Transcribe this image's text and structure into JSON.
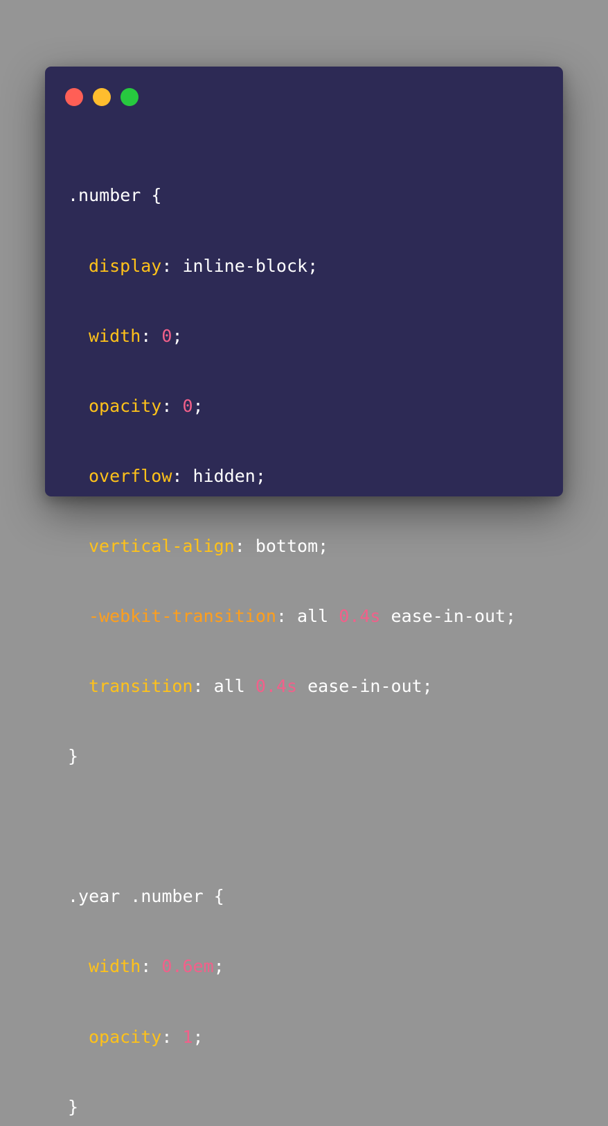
{
  "window": {
    "controls": [
      {
        "name": "close",
        "color": "#ff5f56"
      },
      {
        "name": "minimize",
        "color": "#ffbd2e"
      },
      {
        "name": "maximize",
        "color": "#27c93f"
      }
    ]
  },
  "colors": {
    "background": "#959595",
    "editor": "#2d2a55",
    "property": "#ffc21a",
    "vendor_property": "#ff9f1c",
    "number": "#f2608a",
    "text": "#ffffff"
  },
  "code": {
    "rule1": {
      "selector": ".number {",
      "decls": [
        {
          "prop": "display",
          "colon": ": ",
          "value": "inline-block",
          "end": ";"
        },
        {
          "prop": "width",
          "colon": ": ",
          "num": "0",
          "end": ";"
        },
        {
          "prop": "opacity",
          "colon": ": ",
          "num": "0",
          "end": ";"
        },
        {
          "prop": "overflow",
          "colon": ": ",
          "value": "hidden",
          "end": ";"
        },
        {
          "prop": "vertical-align",
          "colon": ": ",
          "value": "bottom",
          "end": ";"
        },
        {
          "prop": "-webkit-transition",
          "colon": ": ",
          "pre": "all ",
          "num": "0.4s",
          "post": " ease-in-out;"
        },
        {
          "prop": "transition",
          "colon": ": ",
          "pre": "all ",
          "num": "0.4s",
          "post": " ease-in-out;"
        }
      ],
      "close": "}"
    },
    "rule2": {
      "selector": ".year .number {",
      "decls": [
        {
          "prop": "width",
          "colon": ": ",
          "num": "0.6em",
          "end": ";"
        },
        {
          "prop": "opacity",
          "colon": ": ",
          "num": "1",
          "end": ";"
        }
      ],
      "close": "}"
    }
  }
}
